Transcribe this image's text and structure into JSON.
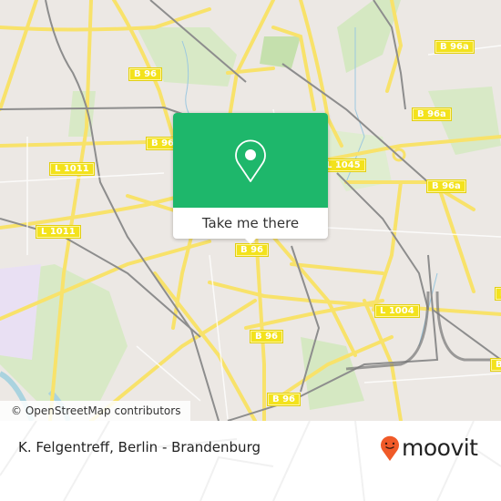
{
  "map": {
    "attribution": "© OpenStreetMap contributors",
    "road_labels": [
      {
        "id": "b96-north",
        "text": "B 96"
      },
      {
        "id": "b96a-ne-1",
        "text": "B 96a"
      },
      {
        "id": "b96a-ne-2",
        "text": "B 96a"
      },
      {
        "id": "b96-west",
        "text": "B 96"
      },
      {
        "id": "l1045",
        "text": "L 1045"
      },
      {
        "id": "b96a-east",
        "text": "B 96a"
      },
      {
        "id": "l1011-a",
        "text": "L 1011"
      },
      {
        "id": "l1011-b",
        "text": "L 1011"
      },
      {
        "id": "b96-center",
        "text": "B 96"
      },
      {
        "id": "l1004",
        "text": "L 1004"
      },
      {
        "id": "b96-south-1",
        "text": "B 96"
      },
      {
        "id": "b96-south-2",
        "text": "B 96"
      },
      {
        "id": "b96-right-edge",
        "text": "B"
      },
      {
        "id": "l-right-edge",
        "text": "L"
      }
    ],
    "colors": {
      "road": "#f8e26a",
      "shield": "#f3e21c",
      "park": "#d5e8c2",
      "water": "#aad3df",
      "rail": "#888888",
      "land": "#ece8e4",
      "industrial": "#e9e0f3"
    }
  },
  "popup": {
    "button_label": "Take me there",
    "icon": "map-pin-icon",
    "color": "#1eb76b"
  },
  "footer": {
    "place_name": "K. Felgentreff, Berlin - Brandenburg",
    "brand": "moovit",
    "brand_color": "#f05a28"
  }
}
